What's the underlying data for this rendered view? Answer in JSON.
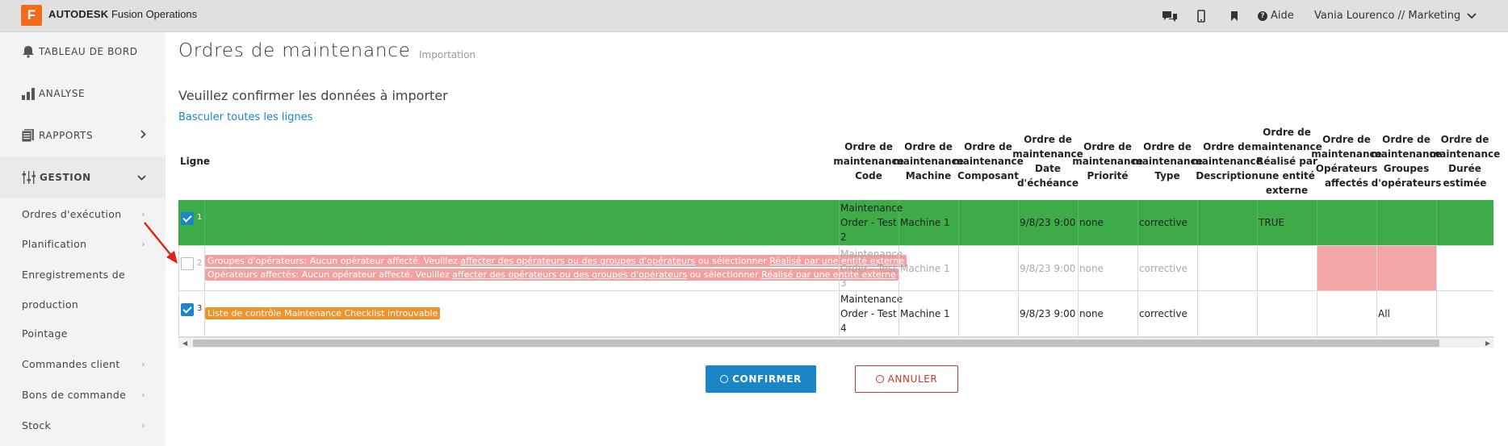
{
  "topbar": {
    "brand_strong": "AUTODESK",
    "brand_rest": "Fusion Operations",
    "logo_letter": "F",
    "help_label": "Aide",
    "user_label": "Vania Lourenco // Marketing"
  },
  "sidebar": {
    "main_items": [
      {
        "label": "TABLEAU DE BORD"
      },
      {
        "label": "ANALYSE"
      },
      {
        "label": "RAPPORTS"
      },
      {
        "label": "GESTION"
      }
    ],
    "sub_items": [
      {
        "label": "Ordres d'exécution"
      },
      {
        "label": "Planification"
      },
      {
        "label": "Enregistrements de"
      },
      {
        "label": "production"
      },
      {
        "label": "Pointage"
      },
      {
        "label": "Commandes client"
      },
      {
        "label": "Bons de commande"
      },
      {
        "label": "Stock"
      }
    ]
  },
  "page": {
    "title": "Ordres de maintenance",
    "subtitle": "Importation",
    "confirm_question": "Veuillez confirmer les données à importer",
    "toggle_all": "Basculer toutes les lignes"
  },
  "table": {
    "line_header": "Ligne",
    "columns": [
      "Ordre de maintenance Code",
      "Ordre de maintenance Machine",
      "Ordre de maintenance Composant",
      "Ordre de maintenance Date d'échéance",
      "Ordre de maintenance Priorité",
      "Ordre de maintenance Type",
      "Ordre de maintenance Description",
      "Ordre de maintenance Réalisé par une entité externe",
      "Ordre de maintenance Opérateurs affectés",
      "Ordre de maintenance Groupes d'opérateurs",
      "Ordre de maintenance Durée estimée"
    ],
    "rows": [
      {
        "line": "1",
        "code": "Maintenance Order - Test 2",
        "machine": "Machine 1",
        "date": "9/8/23 9:00",
        "priority": "none",
        "type": "corrective",
        "external": "TRUE",
        "groups": ""
      },
      {
        "line": "2",
        "code": "Maintenance Order - Test 3",
        "machine": "Machine 1",
        "date": "9/8/23 9:00",
        "priority": "none",
        "type": "corrective",
        "external": "",
        "groups": "",
        "errors": [
          {
            "text": "Groupes d'opérateurs: Aucun opérateur affecté. Veuillez ",
            "link1": "affecter des opérateurs ou des groupes d'opérateurs",
            "mid": " ou sélectionner ",
            "link2": "Réalisé par une entité externe"
          },
          {
            "text": "Opérateurs affectés: Aucun opérateur affecté. Veuillez ",
            "link1": "affecter des opérateurs ou des groupes d'opérateurs",
            "mid": " ou sélectionner ",
            "link2": "Réalisé par une entité externe"
          }
        ]
      },
      {
        "line": "3",
        "code": "Maintenance Order - Test 4",
        "machine": "Machine 1",
        "date": "9/8/23 9:00",
        "priority": "none",
        "type": "corrective",
        "external": "",
        "groups": "All",
        "warning": "Liste de contrôle Maintenance Checklist introuvable"
      }
    ]
  },
  "buttons": {
    "confirm": "CONFIRMER",
    "cancel": "ANNULER"
  },
  "colors": {
    "accent": "#1a86c8",
    "valid_row": "#3cab48",
    "error": "#f2a0a0",
    "warning": "#f0932b",
    "danger": "#c0392b",
    "brand": "#f26a1b"
  }
}
